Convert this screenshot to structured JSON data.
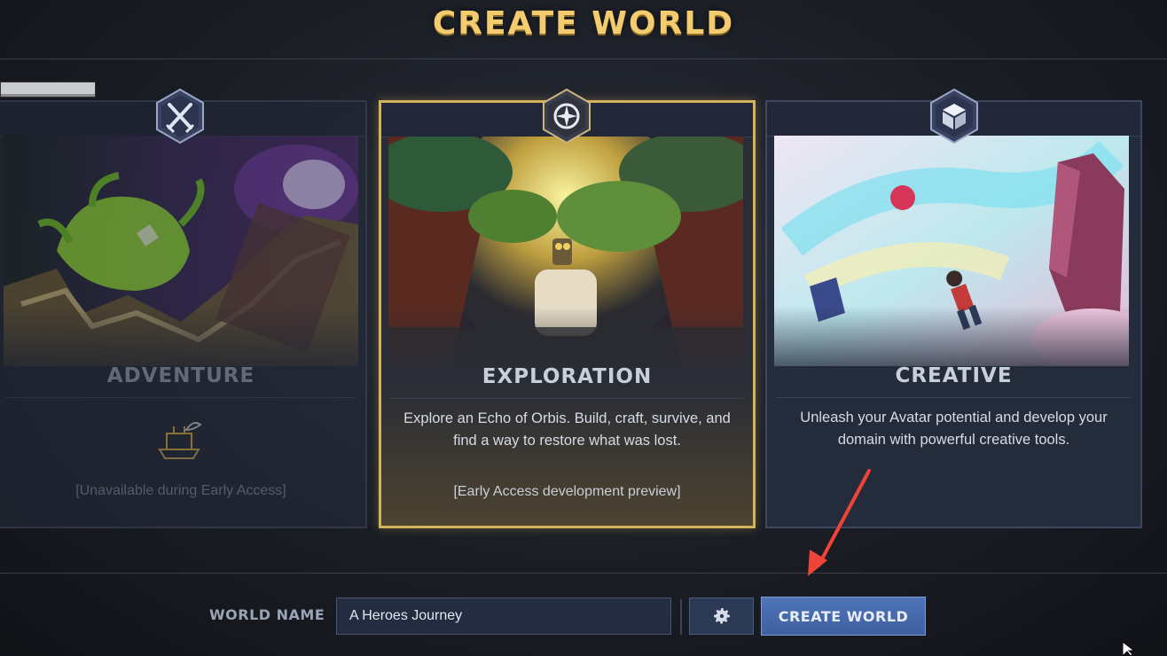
{
  "screen": {
    "title": "CREATE WORLD"
  },
  "modes": [
    {
      "id": "adventure",
      "name": "ADVENTURE",
      "icon": "crossed-swords-icon",
      "description": "",
      "note": "[Unavailable during Early Access]",
      "state": "disabled"
    },
    {
      "id": "exploration",
      "name": "EXPLORATION",
      "icon": "compass-icon",
      "description": "Explore an Echo of Orbis. Build, craft, survive, and find a way to restore what was lost.",
      "note": "[Early Access development preview]",
      "state": "selected"
    },
    {
      "id": "creative",
      "name": "CREATIVE",
      "icon": "cube-icon",
      "description": "Unleash your Avatar potential and develop your domain with powerful creative tools.",
      "note": "",
      "state": "available"
    }
  ],
  "footer": {
    "world_name_label": "WORLD NAME",
    "world_name_value": "A Heroes Journey",
    "settings_icon": "gear-icon",
    "create_button_label": "CREATE WORLD"
  },
  "colors": {
    "title_gold": "#f2cc6e",
    "selected_border": "#d4b25a",
    "button_blue": "#4f74b8",
    "annotation_arrow": "#f04438"
  }
}
